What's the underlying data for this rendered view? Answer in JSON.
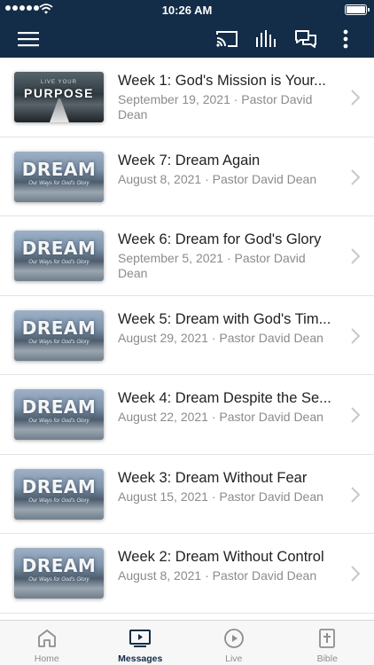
{
  "status_bar": {
    "time": "10:26 AM"
  },
  "nav_bar": {
    "icons": [
      "menu-icon",
      "cast-icon",
      "equalizer-icon",
      "chat-icon",
      "more-icon"
    ]
  },
  "messages": [
    {
      "title": "Week 1: God's Mission is Your...",
      "meta": "September 19, 2021 · Pastor David Dean",
      "thumbnail": {
        "style": "purpose",
        "line1": "LIVE YOUR",
        "line2": "PURPOSE"
      }
    },
    {
      "title": "Week 7: Dream Again",
      "meta": "August 8, 2021 · Pastor David Dean",
      "thumbnail": {
        "style": "dream",
        "line1": "DREAM",
        "line2": "Our Ways for God's Glory"
      }
    },
    {
      "title": "Week 6: Dream for God's Glory",
      "meta": "September 5, 2021 · Pastor David Dean",
      "thumbnail": {
        "style": "dream",
        "line1": "DREAM",
        "line2": "Our Ways for God's Glory"
      }
    },
    {
      "title": "Week 5: Dream with God's Tim...",
      "meta": "August 29, 2021 · Pastor David Dean",
      "thumbnail": {
        "style": "dream",
        "line1": "DREAM",
        "line2": "Our Ways for God's Glory"
      }
    },
    {
      "title": "Week 4: Dream Despite the Se...",
      "meta": "August 22, 2021 · Pastor David Dean",
      "thumbnail": {
        "style": "dream",
        "line1": "DREAM",
        "line2": "Our Ways for God's Glory"
      }
    },
    {
      "title": "Week 3: Dream Without Fear",
      "meta": "August 15, 2021 · Pastor David Dean",
      "thumbnail": {
        "style": "dream",
        "line1": "DREAM",
        "line2": "Our Ways for God's Glory"
      }
    },
    {
      "title": "Week 2: Dream Without Control",
      "meta": "August 8, 2021 · Pastor David Dean",
      "thumbnail": {
        "style": "dream",
        "line1": "DREAM",
        "line2": "Our Ways for God's Glory"
      }
    }
  ],
  "tab_bar": {
    "tabs": [
      {
        "label": "Home",
        "icon": "home-icon",
        "active": false
      },
      {
        "label": "Messages",
        "icon": "messages-icon",
        "active": true
      },
      {
        "label": "Live",
        "icon": "live-icon",
        "active": false
      },
      {
        "label": "Bible",
        "icon": "bible-icon",
        "active": false
      }
    ]
  },
  "colors": {
    "header": "#132c47",
    "active_tab": "#132c47",
    "inactive_tab": "#8e8e8e",
    "title_text": "#222222",
    "meta_text": "#8b8b8b"
  }
}
